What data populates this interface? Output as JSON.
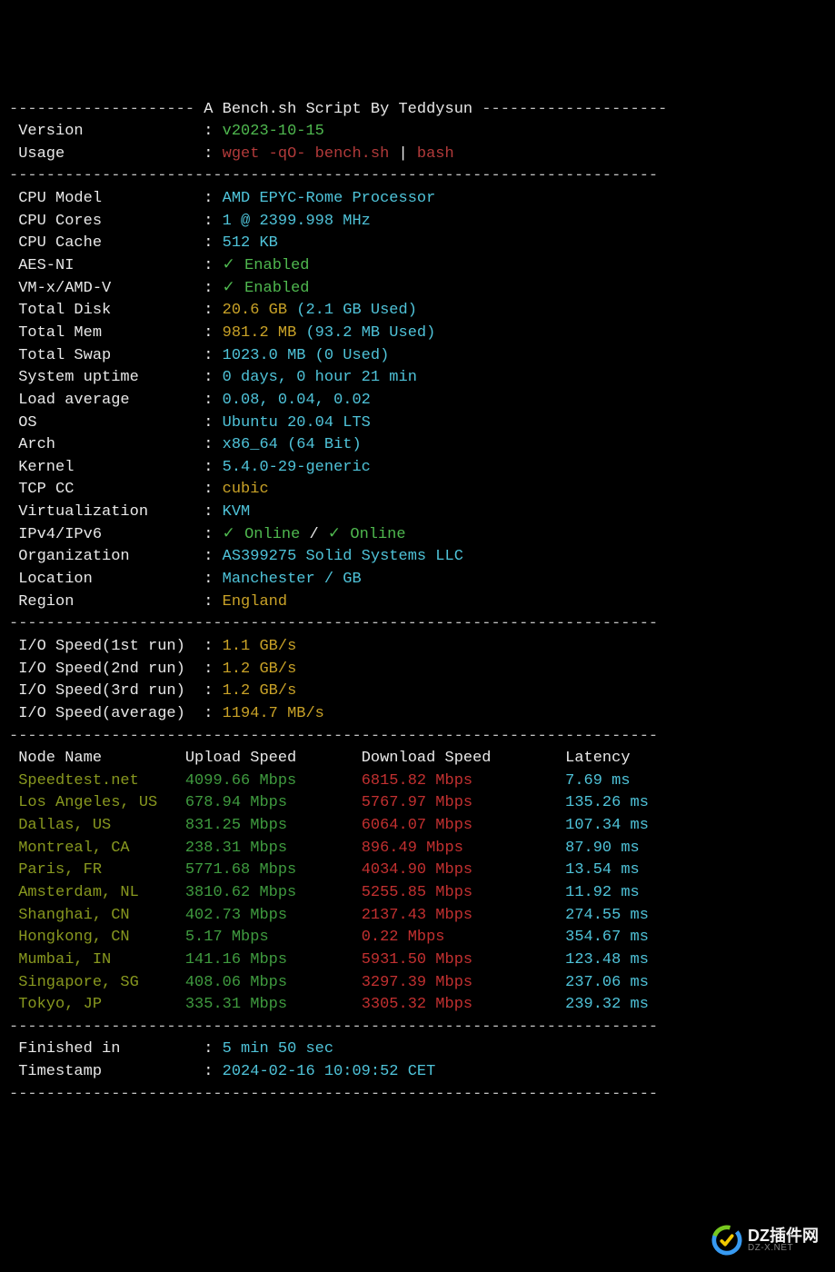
{
  "header": {
    "title": "A Bench.sh Script By Teddysun"
  },
  "meta": {
    "version_label": "Version",
    "version_value": "v2023-10-15",
    "usage_label": "Usage",
    "usage_cmd_wget": "wget -qO- bench.sh",
    "usage_pipe": "|",
    "usage_cmd_bash": "bash"
  },
  "sys": {
    "cpu_model": {
      "label": "CPU Model",
      "value": "AMD EPYC-Rome Processor"
    },
    "cpu_cores": {
      "label": "CPU Cores",
      "value": "1 @ 2399.998 MHz"
    },
    "cpu_cache": {
      "label": "CPU Cache",
      "value": "512 KB"
    },
    "aes_ni": {
      "label": "AES-NI",
      "check": "✓",
      "value": "Enabled"
    },
    "vmx": {
      "label": "VM-x/AMD-V",
      "check": "✓",
      "value": "Enabled"
    },
    "disk": {
      "label": "Total Disk",
      "main": "20.6 GB",
      "paren": "(2.1 GB Used)"
    },
    "mem": {
      "label": "Total Mem",
      "main": "981.2 MB",
      "paren": "(93.2 MB Used)"
    },
    "swap": {
      "label": "Total Swap",
      "value": "1023.0 MB (0 Used)"
    },
    "uptime": {
      "label": "System uptime",
      "value": "0 days, 0 hour 21 min"
    },
    "load": {
      "label": "Load average",
      "value": "0.08, 0.04, 0.02"
    },
    "os": {
      "label": "OS",
      "value": "Ubuntu 20.04 LTS"
    },
    "arch": {
      "label": "Arch",
      "value": "x86_64 (64 Bit)"
    },
    "kernel": {
      "label": "Kernel",
      "value": "5.4.0-29-generic"
    },
    "tcpcc": {
      "label": "TCP CC",
      "value": "cubic"
    },
    "virt": {
      "label": "Virtualization",
      "value": "KVM"
    },
    "ipv": {
      "label": "IPv4/IPv6",
      "check1": "✓",
      "v1": "Online",
      "sep": "/",
      "check2": "✓",
      "v2": "Online"
    },
    "org": {
      "label": "Organization",
      "value": "AS399275 Solid Systems LLC"
    },
    "loc": {
      "label": "Location",
      "value": "Manchester / GB"
    },
    "region": {
      "label": "Region",
      "value": "England"
    }
  },
  "io": {
    "r1": {
      "label": "I/O Speed(1st run)",
      "value": "1.1 GB/s"
    },
    "r2": {
      "label": "I/O Speed(2nd run)",
      "value": "1.2 GB/s"
    },
    "r3": {
      "label": "I/O Speed(3rd run)",
      "value": "1.2 GB/s"
    },
    "avg": {
      "label": "I/O Speed(average)",
      "value": "1194.7 MB/s"
    }
  },
  "speedtest": {
    "headers": {
      "node": "Node Name",
      "up": "Upload Speed",
      "down": "Download Speed",
      "lat": "Latency"
    },
    "rows": [
      {
        "node": "Speedtest.net",
        "up": "4099.66 Mbps",
        "down": "6815.82 Mbps",
        "lat": "7.69 ms"
      },
      {
        "node": "Los Angeles, US",
        "up": "678.94 Mbps",
        "down": "5767.97 Mbps",
        "lat": "135.26 ms"
      },
      {
        "node": "Dallas, US",
        "up": "831.25 Mbps",
        "down": "6064.07 Mbps",
        "lat": "107.34 ms"
      },
      {
        "node": "Montreal, CA",
        "up": "238.31 Mbps",
        "down": "896.49 Mbps",
        "lat": "87.90 ms"
      },
      {
        "node": "Paris, FR",
        "up": "5771.68 Mbps",
        "down": "4034.90 Mbps",
        "lat": "13.54 ms"
      },
      {
        "node": "Amsterdam, NL",
        "up": "3810.62 Mbps",
        "down": "5255.85 Mbps",
        "lat": "11.92 ms"
      },
      {
        "node": "Shanghai, CN",
        "up": "402.73 Mbps",
        "down": "2137.43 Mbps",
        "lat": "274.55 ms"
      },
      {
        "node": "Hongkong, CN",
        "up": "5.17 Mbps",
        "down": "0.22 Mbps",
        "lat": "354.67 ms"
      },
      {
        "node": "Mumbai, IN",
        "up": "141.16 Mbps",
        "down": "5931.50 Mbps",
        "lat": "123.48 ms"
      },
      {
        "node": "Singapore, SG",
        "up": "408.06 Mbps",
        "down": "3297.39 Mbps",
        "lat": "237.06 ms"
      },
      {
        "node": "Tokyo, JP",
        "up": "335.31 Mbps",
        "down": "3305.32 Mbps",
        "lat": "239.32 ms"
      }
    ]
  },
  "footer": {
    "finished": {
      "label": "Finished in",
      "value": "5 min 50 sec"
    },
    "timestamp": {
      "label": "Timestamp",
      "value": "2024-02-16 10:09:52 CET"
    }
  },
  "watermark": {
    "big": "DZ插件网",
    "small": "DZ-X.NET"
  },
  "dashline": "----------------------------------------------------------------------",
  "dashhalf1": "--------------------",
  "dashhalf2": "--------------------"
}
